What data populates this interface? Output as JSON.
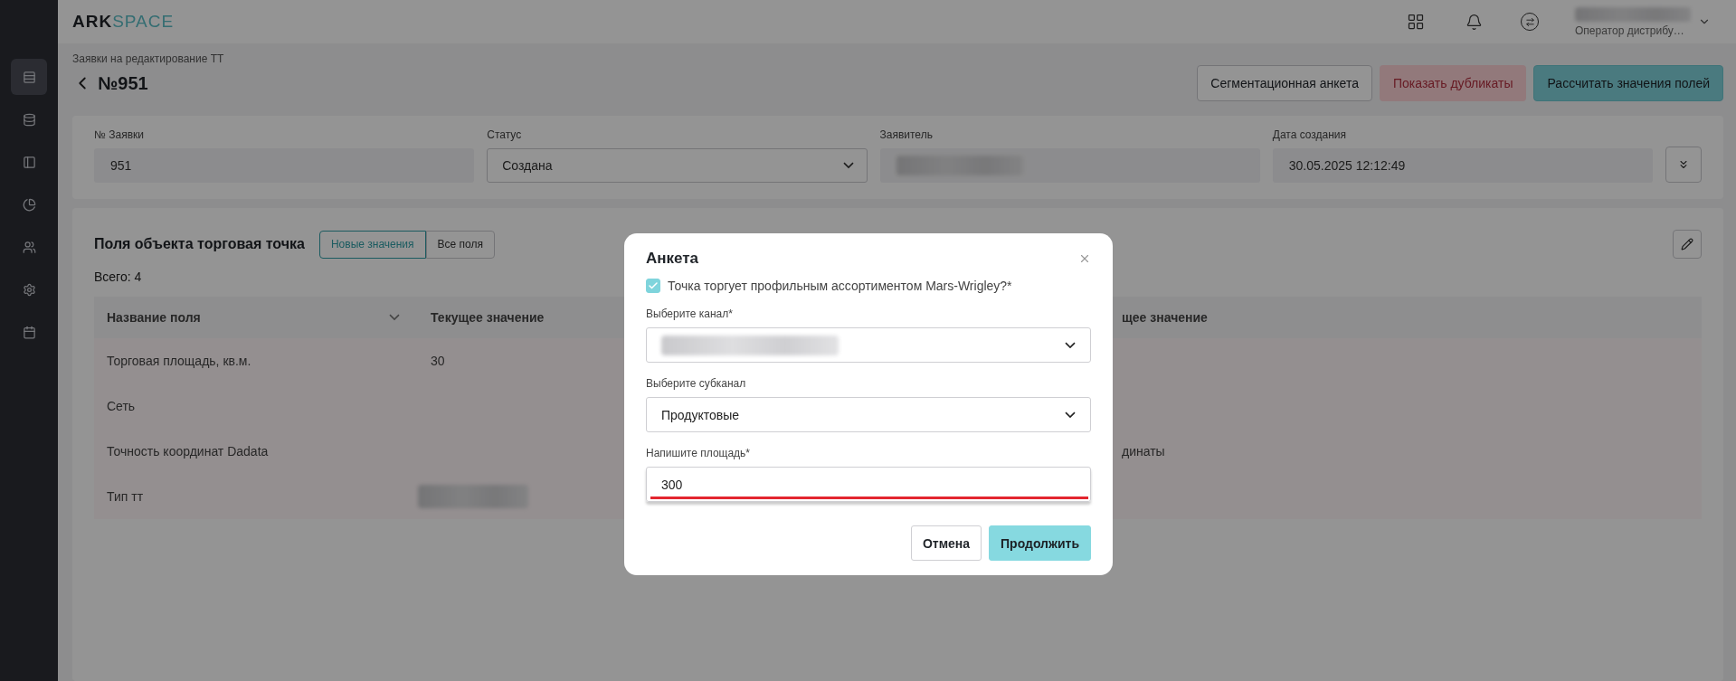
{
  "header": {
    "logo_primary": "ARK",
    "logo_accent": "SPACE",
    "user": {
      "name_redacted": true,
      "role": "Оператор дистрибу…"
    }
  },
  "sidebar": {
    "items": [
      {
        "selected": true
      },
      {
        "selected": false
      },
      {
        "selected": false
      },
      {
        "selected": false
      },
      {
        "selected": false
      },
      {
        "selected": false
      },
      {
        "selected": false
      }
    ]
  },
  "breadcrumb": "Заявки на редактирование ТТ",
  "title": "№951",
  "actions": [
    {
      "label": "Сегментационная анкета",
      "kind": "outline",
      "disabled": false
    },
    {
      "label": "Показать дубликаты",
      "kind": "danger",
      "disabled": true
    },
    {
      "label": "Рассчитать значения полей",
      "kind": "primary",
      "disabled": false
    }
  ],
  "summary": {
    "fields": [
      {
        "label": "№ Заявки",
        "kind": "text",
        "value": "951"
      },
      {
        "label": "Статус",
        "kind": "select",
        "value": "Создана"
      },
      {
        "label": "Заявитель",
        "kind": "redacted"
      },
      {
        "label": "Дата создания",
        "kind": "text",
        "value": "30.05.2025 12:12:49"
      }
    ]
  },
  "fields_panel": {
    "title": "Поля объекта торговая точка",
    "tabs": [
      {
        "label": "Новые значения",
        "selected": true
      },
      {
        "label": "Все поля",
        "selected": false
      }
    ],
    "total": "Всего: 4",
    "table": {
      "columns": [
        "Название поля",
        "Текущее значение",
        "щее значение"
      ],
      "rows": [
        {
          "name": "Торговая площадь, кв.м.",
          "current": {
            "kind": "text",
            "text": "30"
          }
        },
        {
          "name": "Сеть"
        },
        {
          "name": "Точность координат Dadata",
          "column_3": "динаты"
        },
        {
          "name": "Тип тт",
          "current": {
            "kind": "redacted"
          }
        }
      ]
    }
  },
  "modal": {
    "title": "Анкета",
    "checkbox": {
      "label": "Точка торгует профильным ассортиментом Mars-Wrigley?*",
      "checked": true
    },
    "fields": [
      {
        "label": "Выберите канал*",
        "kind": "select",
        "redacted": true
      },
      {
        "label": "Выберите субканал",
        "kind": "select",
        "value": "Продуктовые"
      },
      {
        "label": "Напишите площадь*",
        "kind": "input",
        "value": "300",
        "highlighted": true
      }
    ],
    "buttons": [
      {
        "label": "Отмена",
        "kind": "secondary"
      },
      {
        "label": "Продолжить",
        "kind": "primary"
      }
    ]
  }
}
